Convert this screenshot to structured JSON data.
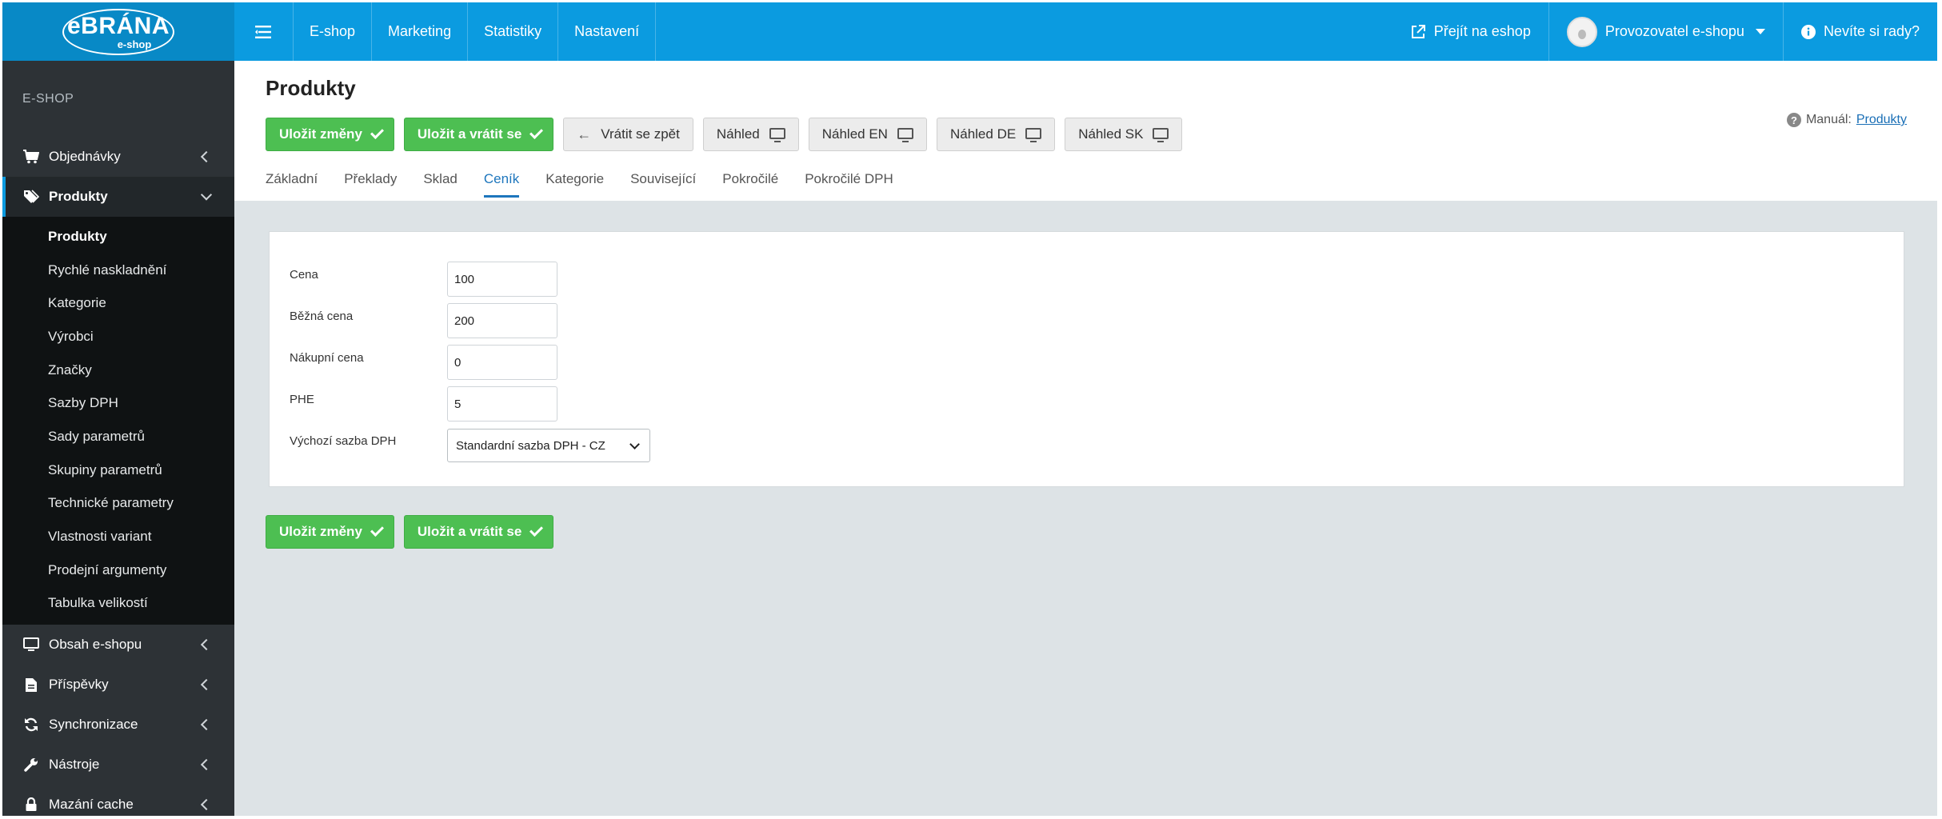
{
  "brand": {
    "logo_main": "eBRÁNA",
    "logo_sub": "e-shop"
  },
  "topnav": {
    "items": [
      "E-shop",
      "Marketing",
      "Statistiky",
      "Nastavení"
    ],
    "goto_eshop": "Přejít na eshop",
    "user": "Provozovatel e-shopu",
    "help": "Nevíte si rady?"
  },
  "sidebar": {
    "section": "E-SHOP",
    "orders": "Objednávky",
    "products": "Produkty",
    "sub_items": [
      "Produkty",
      "Rychlé naskladnění",
      "Kategorie",
      "Výrobci",
      "Značky",
      "Sazby DPH",
      "Sady parametrů",
      "Skupiny parametrů",
      "Technické parametry",
      "Vlastnosti variant",
      "Prodejní argumenty",
      "Tabulka velikostí"
    ],
    "bottom_items": [
      "Obsah e-shopu",
      "Příspěvky",
      "Synchronizace",
      "Nástroje",
      "Mazání cache"
    ]
  },
  "page": {
    "title": "Produkty",
    "save": "Uložit změny",
    "save_return": "Uložit a vrátit se",
    "back": "Vrátit se zpět",
    "previews": [
      "Náhled",
      "Náhled EN",
      "Náhled DE",
      "Náhled SK"
    ],
    "manual_label": "Manuál:",
    "manual_link": "Produkty",
    "tabs": [
      "Základní",
      "Překlady",
      "Sklad",
      "Ceník",
      "Kategorie",
      "Související",
      "Pokročilé",
      "Pokročilé DPH"
    ],
    "active_tab": "Ceník"
  },
  "form": {
    "price_label": "Cena",
    "price": "100",
    "regular_price_label": "Běžná cena",
    "regular_price": "200",
    "purchase_price_label": "Nákupní cena",
    "purchase_price": "0",
    "phe_label": "PHE",
    "phe": "5",
    "vat_label": "Výchozí sazba DPH",
    "vat": "Standardní sazba DPH - CZ"
  },
  "colors": {
    "topbar": "#0b9be0",
    "sidebar": "#2d3236",
    "green": "#4dbf52",
    "accent": "#1d76bd"
  }
}
